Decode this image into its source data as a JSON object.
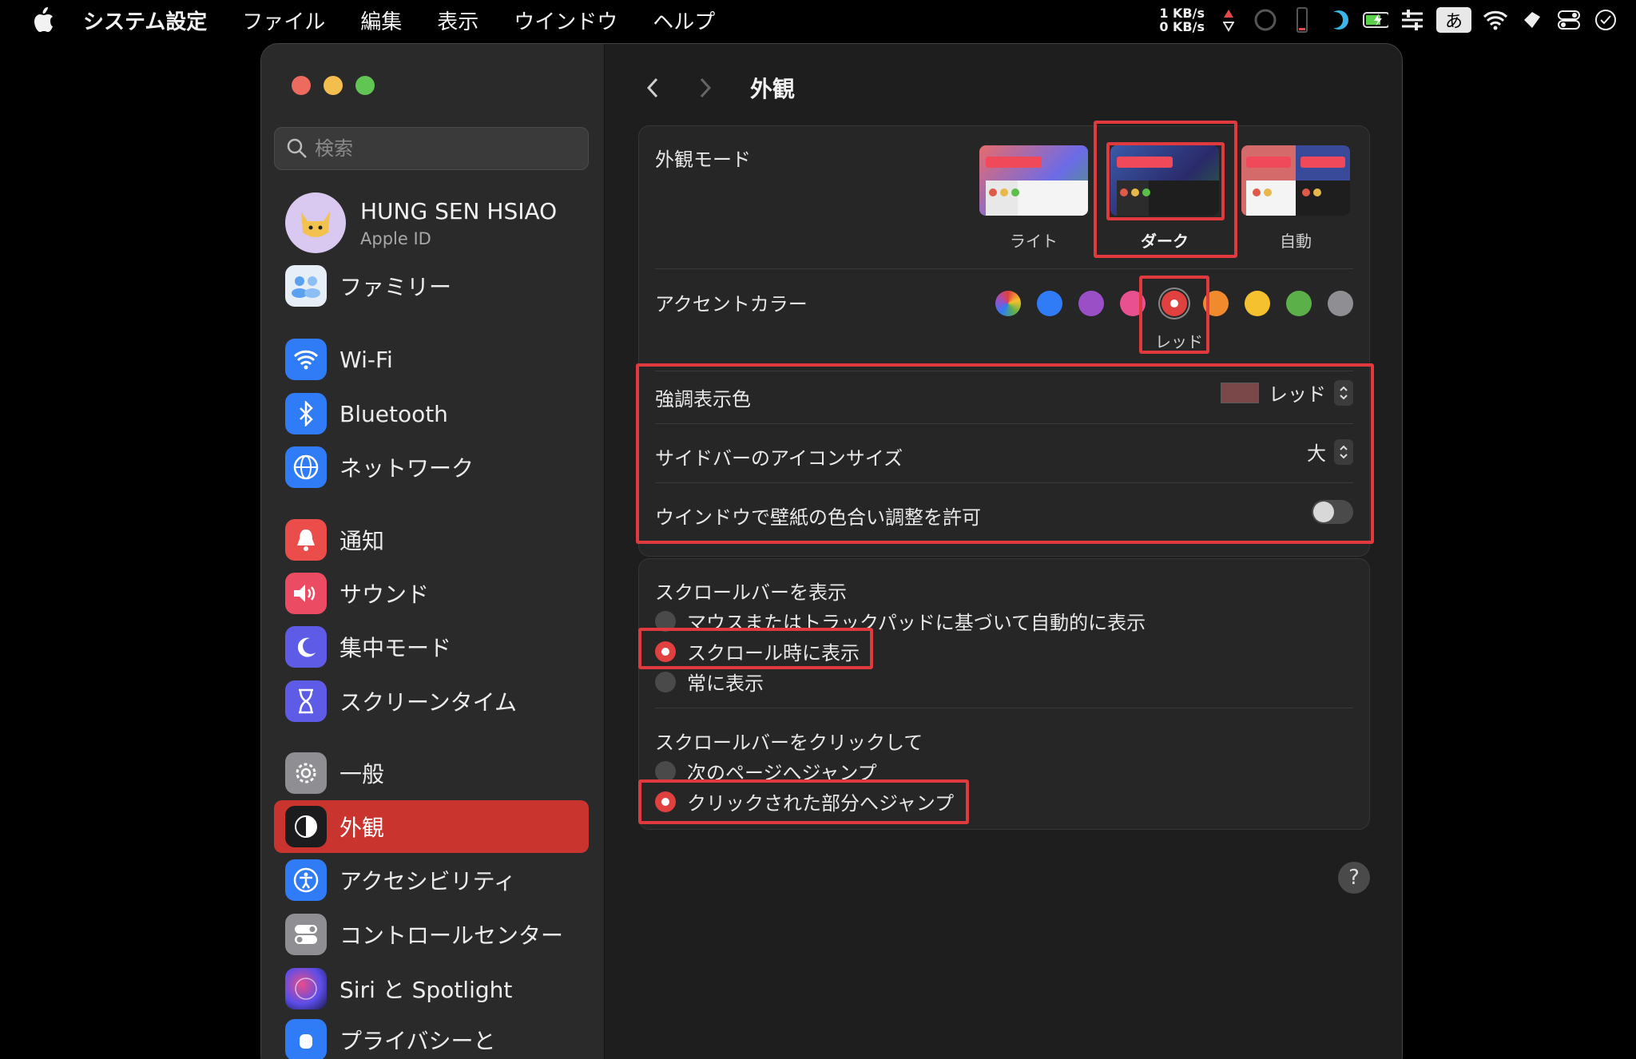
{
  "menubar": {
    "app_name": "システム設定",
    "items": [
      "ファイル",
      "編集",
      "表示",
      "ウインドウ",
      "ヘルプ"
    ],
    "net_up": "1 KB/s",
    "net_down": "0 KB/s",
    "ime": "あ"
  },
  "sidebar": {
    "search_placeholder": "検索",
    "profile": {
      "name": "HUNG SEN HSIAO",
      "sub": "Apple ID"
    },
    "items": [
      {
        "label": "ファミリー",
        "icon": "family-icon",
        "color": "#5aa2f0"
      },
      {
        "label": "Wi-Fi",
        "icon": "wifi-icon",
        "color": "#2f7cf6"
      },
      {
        "label": "Bluetooth",
        "icon": "bluetooth-icon",
        "color": "#2f7cf6"
      },
      {
        "label": "ネットワーク",
        "icon": "globe-icon",
        "color": "#2f7cf6"
      },
      {
        "label": "通知",
        "icon": "bell-icon",
        "color": "#eb4d4b"
      },
      {
        "label": "サウンド",
        "icon": "speaker-icon",
        "color": "#eb4b63"
      },
      {
        "label": "集中モード",
        "icon": "moon-icon",
        "color": "#5e5ce6"
      },
      {
        "label": "スクリーンタイム",
        "icon": "hourglass-icon",
        "color": "#5e5ce6"
      },
      {
        "label": "一般",
        "icon": "gear-icon",
        "color": "#8e8e93"
      },
      {
        "label": "外観",
        "icon": "appearance-icon",
        "color": "#1c1c1e"
      },
      {
        "label": "アクセシビリティ",
        "icon": "accessibility-icon",
        "color": "#2f7cf6"
      },
      {
        "label": "コントロールセンター",
        "icon": "control-center-icon",
        "color": "#8e8e93"
      },
      {
        "label": "Siri と Spotlight",
        "icon": "siri-icon",
        "color": "#3a3a8c"
      },
      {
        "label": "プライバシーと",
        "icon": "hand-icon",
        "color": "#2f7cf6"
      }
    ],
    "selected_label": "外観"
  },
  "content": {
    "title": "外観",
    "appearance_mode": {
      "label": "外観モード",
      "options": [
        "ライト",
        "ダーク",
        "自動"
      ],
      "selected": "ダーク"
    },
    "accent": {
      "label": "アクセントカラー",
      "colors": [
        "multicolor",
        "#2f7cf6",
        "#9b4fc7",
        "#e8508f",
        "#e0403e",
        "#f08a2c",
        "#f5c12e",
        "#5bb04a",
        "#8e8e93"
      ],
      "selected_name": "レッド"
    },
    "highlight": {
      "label": "強調表示色",
      "value": "レッド",
      "swatch": "#7a4848"
    },
    "sidebar_icon_size": {
      "label": "サイドバーのアイコンサイズ",
      "value": "大"
    },
    "wallpaper_tinting": {
      "label": "ウインドウで壁紙の色合い調整を許可",
      "on": false
    },
    "scrollbars": {
      "label": "スクロールバーを表示",
      "options": [
        "マウスまたはトラックパッドに基づいて自動的に表示",
        "スクロール時に表示",
        "常に表示"
      ],
      "selected": "スクロール時に表示"
    },
    "click_scrollbar": {
      "label": "スクロールバーをクリックして",
      "options": [
        "次のページへジャンプ",
        "クリックされた部分へジャンプ"
      ],
      "selected": "クリックされた部分へジャンプ"
    },
    "help": "?"
  }
}
